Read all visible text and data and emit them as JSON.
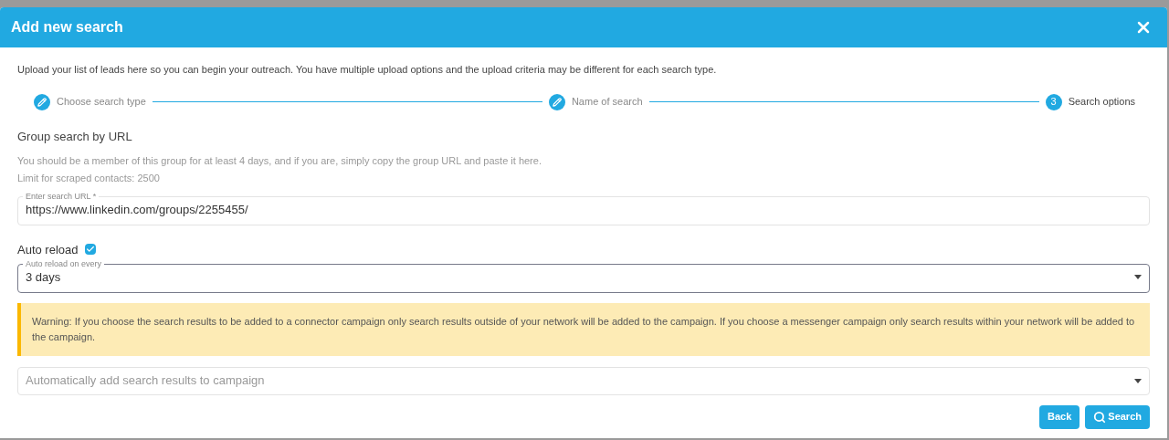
{
  "dialog": {
    "title": "Add new search",
    "intro": "Upload your list of leads here so you can begin your outreach. You have multiple upload options and the upload criteria may be different for each search type.",
    "steps": [
      {
        "label": "Choose search type",
        "kind": "done",
        "selected": false
      },
      {
        "label": "Name of search",
        "kind": "done",
        "selected": false
      },
      {
        "label": "Search options",
        "kind": "current",
        "number": "3",
        "selected": true
      }
    ],
    "section_title": "Group search by URL",
    "help_lines": [
      "You should be a member of this group for at least 4 days, and if you are, simply copy the group URL and paste it here.",
      "Limit for scraped contacts: 2500"
    ],
    "url_field": {
      "label": "Enter search URL *",
      "value": "https://www.linkedin.com/groups/2255455/"
    },
    "auto_reload": {
      "label": "Auto reload",
      "checked": true
    },
    "reload_select": {
      "label": "Auto reload on every",
      "value": "3 days"
    },
    "warning": "Warning: If you choose the search results to be added to a connector campaign only search results outside of your network will be added to the campaign. If you choose a messenger campaign only search results within your network will be added to the campaign.",
    "campaign_select": {
      "placeholder": "Automatically add search results to campaign"
    },
    "buttons": [
      {
        "label": "Back",
        "kind": "plain"
      },
      {
        "label": "Search",
        "kind": "search"
      }
    ]
  }
}
